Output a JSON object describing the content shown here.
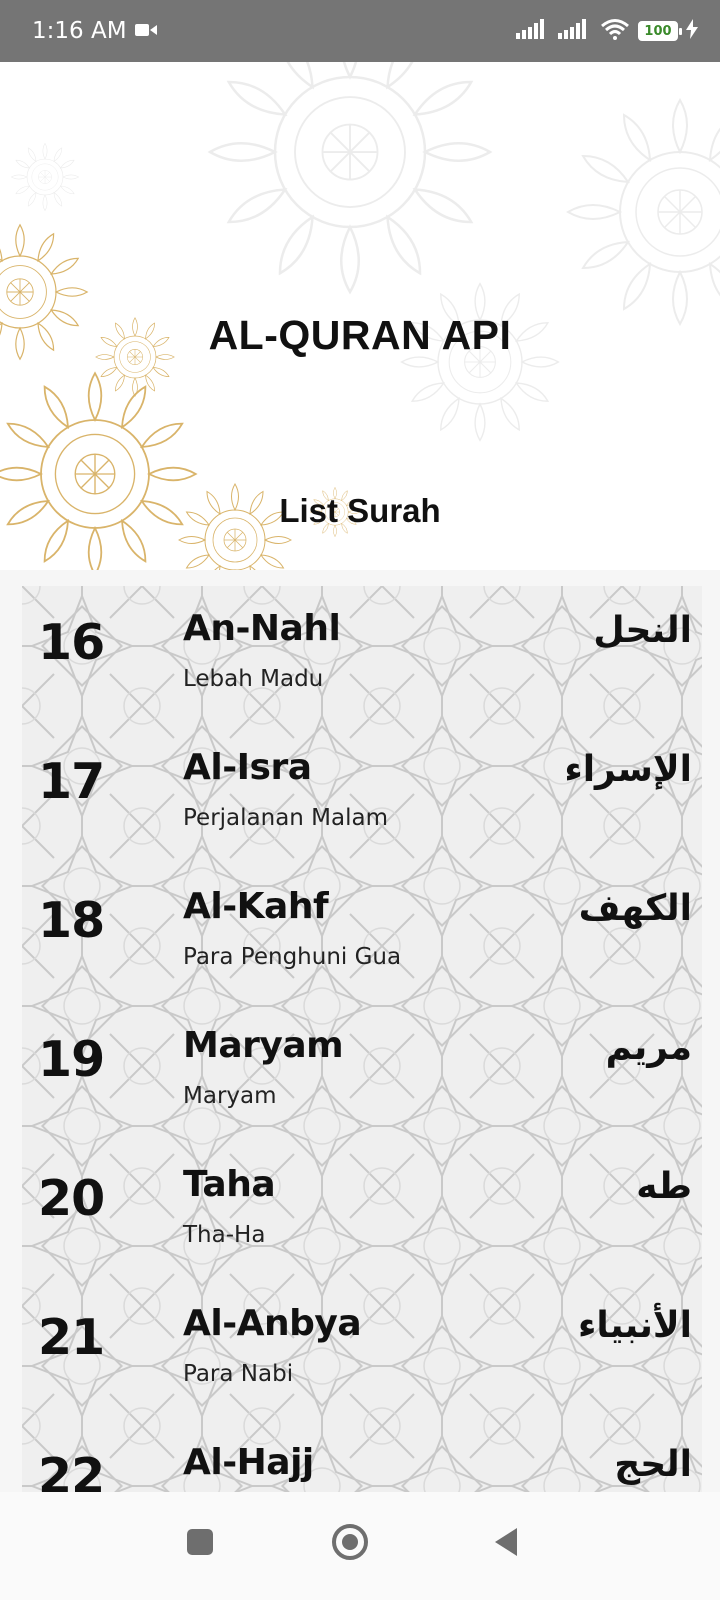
{
  "status_bar": {
    "time": "1:16 AM",
    "battery": "100",
    "icons": [
      "video-icon",
      "signal-icon",
      "signal-icon",
      "wifi-icon",
      "battery-icon",
      "charging-icon"
    ]
  },
  "header": {
    "title": "AL-QURAN API",
    "subtitle": "List Surah"
  },
  "surahs": [
    {
      "number": "16",
      "name": "An-Nahl",
      "meaning": "Lebah Madu",
      "arabic": "النحل"
    },
    {
      "number": "17",
      "name": "Al-Isra",
      "meaning": "Perjalanan Malam",
      "arabic": "الإسراء"
    },
    {
      "number": "18",
      "name": "Al-Kahf",
      "meaning": "Para Penghuni Gua",
      "arabic": "الكهف"
    },
    {
      "number": "19",
      "name": "Maryam",
      "meaning": "Maryam",
      "arabic": "مريم"
    },
    {
      "number": "20",
      "name": "Taha",
      "meaning": "Tha-Ha",
      "arabic": "طه"
    },
    {
      "number": "21",
      "name": "Al-Anbya",
      "meaning": "Para Nabi",
      "arabic": "الأنبياء"
    },
    {
      "number": "22",
      "name": "Al-Hajj",
      "meaning": "",
      "arabic": "الحج"
    }
  ],
  "nav_bar": {
    "buttons": [
      "recents-button",
      "home-button",
      "back-button"
    ]
  },
  "colors": {
    "status_bar_bg": "#757575",
    "list_bg": "#efefef",
    "ornament_gold": "#d9b46a"
  }
}
